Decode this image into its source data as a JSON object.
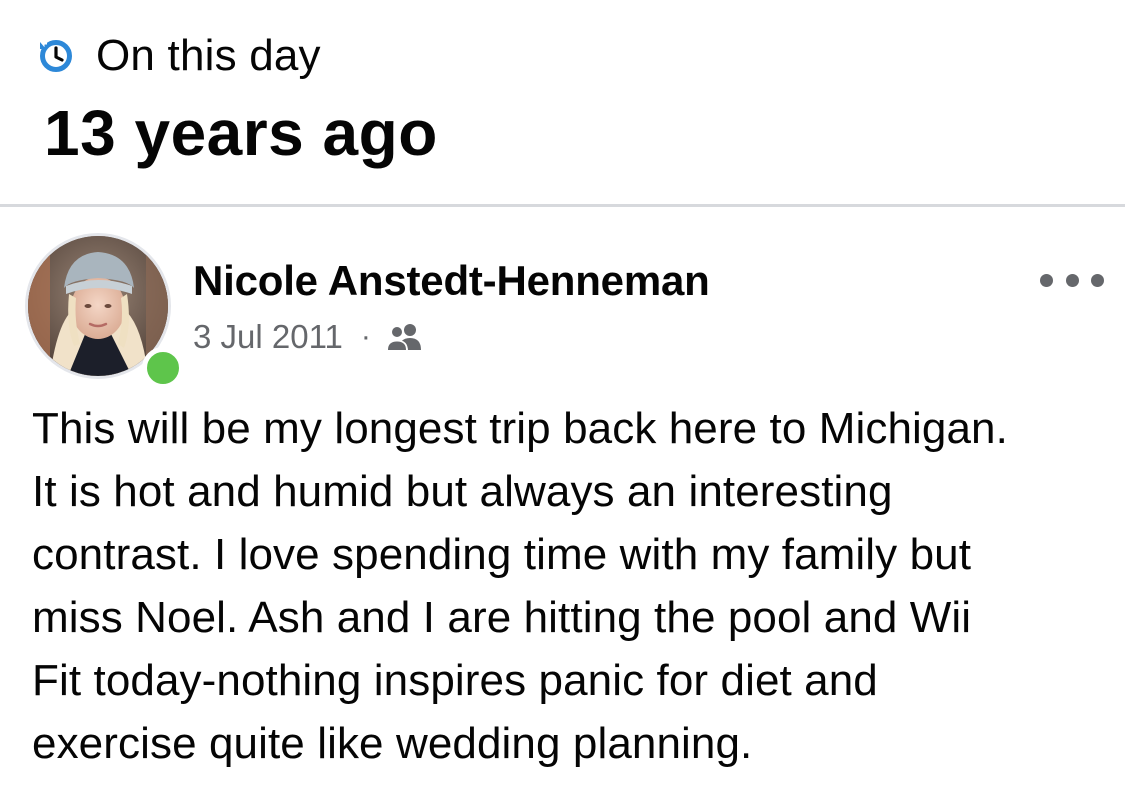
{
  "header": {
    "section_label": "On this day",
    "section_icon": "clock-history-icon",
    "time_ago": "13 years ago"
  },
  "post": {
    "author": {
      "name": "Nicole Anstedt-Henneman",
      "online": true
    },
    "date": "3 Jul 2011",
    "separator": "·",
    "audience_icon": "friends-icon",
    "more_icon": "more-options-icon",
    "text": "This will be my longest trip back here to Michigan.\nIt is hot and humid but always an interesting\ncontrast. I love spending time with my family but\nmiss Noel. Ash and I are hitting the pool and Wii\nFit today-nothing inspires panic for diet and\nexercise quite like wedding planning."
  },
  "colors": {
    "icon_blue": "#1877f2",
    "meta_gray": "#65676b",
    "online_green": "#5ec54b",
    "divider": "#d7d9dd"
  }
}
